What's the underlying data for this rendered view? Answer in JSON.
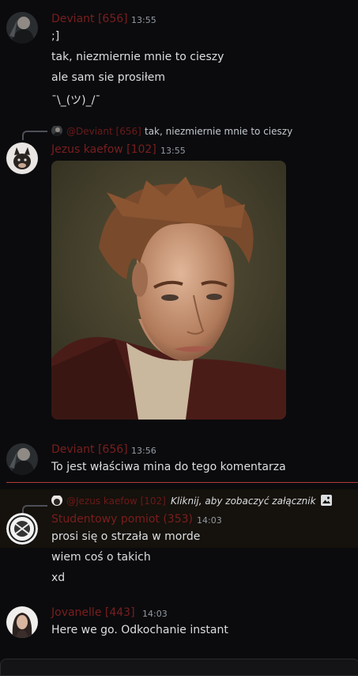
{
  "messages": [
    {
      "author": "Deviant [656]",
      "time": "13:55",
      "lines": [
        ";]",
        "tak, niezmiernie mnie to cieszy",
        "ale sam sie prosiłem",
        "¯\\_(ツ)_/¯"
      ]
    },
    {
      "reply_to": {
        "author": "@Deviant [656]",
        "text": "tak, niezmiernie mnie to cieszy"
      },
      "author": "Jezus kaefow [102]",
      "time": "13:55",
      "image_alt": "portrait of a man with spiky brown hair"
    },
    {
      "author": "Deviant [656]",
      "time": "13:56",
      "lines": [
        "To jest właściwa mina do tego komentarza"
      ]
    },
    {
      "reply_to": {
        "author": "@Jezus kaefow [102]",
        "text": "Kliknij, aby zobaczyć załącznik"
      },
      "author": "Studentowy pomiot (353)",
      "time": "14:03",
      "lines": [
        "prosi się o strzała w morde",
        "wiem coś o takich",
        "xd"
      ]
    },
    {
      "author": "Jovanelle [443]",
      "time": "14:03",
      "lines": [
        "Here we go. Odkochanie instant"
      ]
    }
  ],
  "colors": {
    "background": "#0b0b0d",
    "author_name": "#7a1e1e",
    "new_messages_divider": "#b33a3a",
    "highlight_row": "#15110c"
  }
}
